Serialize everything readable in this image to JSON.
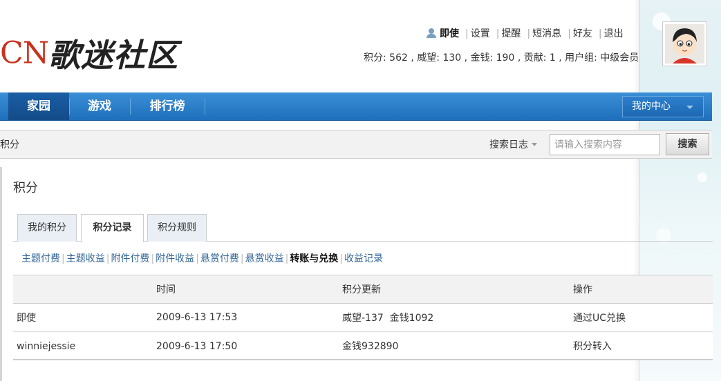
{
  "logo": {
    "latin": "CN",
    "cjk": "歌迷社区"
  },
  "user": {
    "name": "即使",
    "links": [
      "设置",
      "提醒",
      "短消息",
      "好友",
      "退出"
    ],
    "stats": "积分: 562 , 威望: 130 , 金钱: 190 , 贡献: 1 , 用户组: 中级会员"
  },
  "nav": {
    "items": [
      "家园",
      "游戏",
      "排行榜"
    ],
    "my_center": "我的中心"
  },
  "breadcrumb": {
    "current": "积分"
  },
  "search": {
    "scope": "搜索日志",
    "placeholder": "请输入搜索内容",
    "button": "搜索"
  },
  "page": {
    "title": "积分",
    "tabs": [
      "我的积分",
      "积分记录",
      "积分规则"
    ],
    "active_tab": "积分记录",
    "subnav": [
      "主题付费",
      "主题收益",
      "附件付费",
      "附件收益",
      "悬赏付费",
      "悬赏收益",
      "转账与兑换",
      "收益记录"
    ],
    "active_subnav": "转账与兑换"
  },
  "table": {
    "headers": [
      "",
      "时间",
      "积分更新",
      "操作"
    ],
    "rows": [
      [
        "即使",
        "2009-6-13 17:53",
        "威望-137  金钱1092",
        "通过UC兑换"
      ],
      [
        "winniejessie",
        "2009-6-13 17:50",
        "金钱932890",
        "积分转入"
      ]
    ]
  },
  "colors": {
    "nav_blue": "#1f6fbc",
    "logo_red": "#c8321e",
    "link_blue": "#336699"
  }
}
